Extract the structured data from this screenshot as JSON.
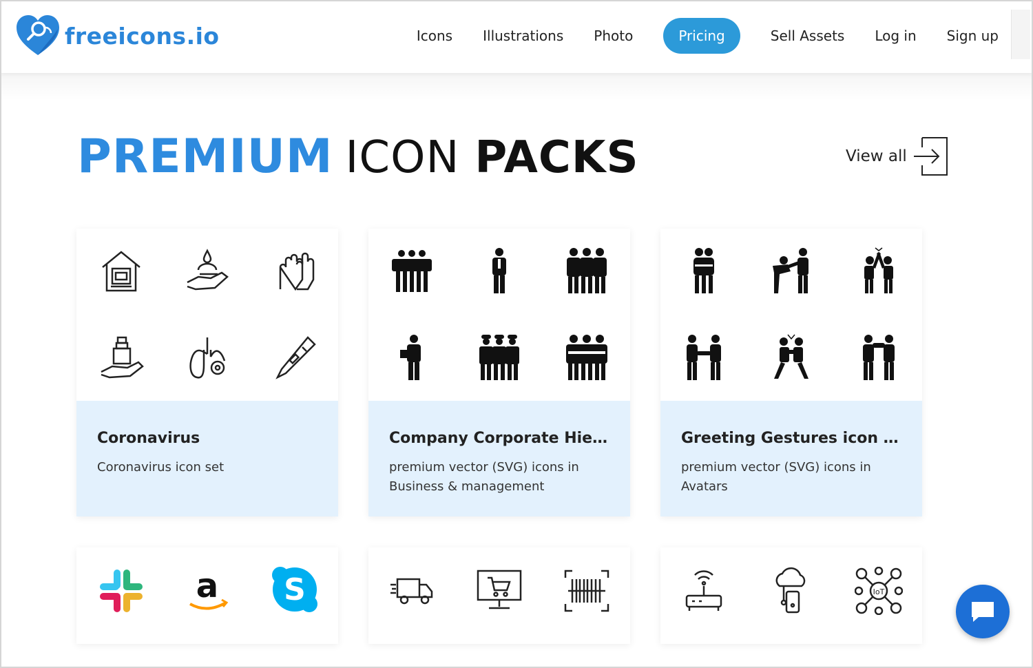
{
  "brand": {
    "name": "freeicons.io",
    "logo_icon": "heart-search-logo-icon",
    "color": "#2b86d9"
  },
  "nav": {
    "items": [
      "Icons",
      "Illustrations",
      "Photo",
      "Pricing",
      "Sell Assets",
      "Log in",
      "Sign up"
    ],
    "active": "Pricing",
    "active_color": "#2c9ad9"
  },
  "section": {
    "title_part1": "PREMIUM",
    "title_part2": "ICON",
    "title_part3": "PACKS",
    "accent_color": "#2e8bdf",
    "view_all": "View all",
    "view_all_icon": "arrow-right-into-box-icon"
  },
  "packs": [
    {
      "title": "Coronavirus",
      "description": "Coronavirus icon set",
      "icons": [
        "home-quarantine-icon",
        "hand-washing-icon",
        "gloves-icon",
        "hand-sanitizer-icon",
        "lungs-virus-icon",
        "thermometer-icon"
      ]
    },
    {
      "title": "Company Corporate Hier...",
      "description": "premium vector (SVG) icons in Business & management",
      "icons": [
        "team-group-icon",
        "businessman-icon",
        "business-team-icon",
        "employee-with-laptop-icon",
        "workers-group-icon",
        "crossed-arms-team-icon"
      ]
    },
    {
      "title": "Greeting Gestures icon set",
      "description": "premium vector (SVG) icons in Avatars",
      "icons": [
        "hug-icon",
        "bow-greeting-icon",
        "high-five-icon",
        "handshake-icon",
        "fist-bump-icon",
        "greeting-hands-icon"
      ]
    }
  ],
  "packs_row2": [
    {
      "icons": [
        "slack-logo-icon",
        "amazon-logo-icon",
        "skype-logo-icon"
      ]
    },
    {
      "icons": [
        "delivery-truck-icon",
        "online-shopping-monitor-icon",
        "barcode-scan-icon"
      ]
    },
    {
      "icons": [
        "wifi-router-icon",
        "cloud-phone-icon",
        "iot-network-icon"
      ]
    }
  ],
  "chat": {
    "icon": "chat-bubble-icon",
    "color": "#1d6fd6"
  }
}
